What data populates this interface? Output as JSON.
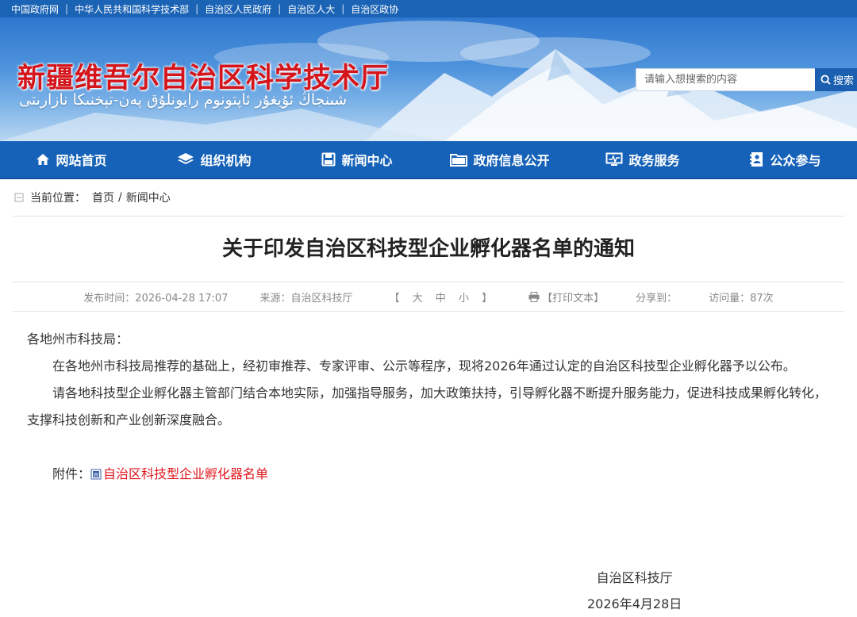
{
  "topbar": {
    "links": [
      "中国政府网",
      "中华人民共和国科学技术部",
      "自治区人民政府",
      "自治区人大",
      "自治区政协"
    ]
  },
  "banner": {
    "title": "新疆维吾尔自治区科学技术厅",
    "subtitle": "شىنجاڭ ئۇيغۇر ئاپتونوم رايونلۇق پەن-تېخنىكا نازارىتى",
    "title_color": "#d4151b"
  },
  "search": {
    "placeholder": "请输入想搜索的内容",
    "button_label": "搜索"
  },
  "nav": {
    "items": [
      {
        "label": "网站首页",
        "icon": "home-icon"
      },
      {
        "label": "组织机构",
        "icon": "layers-icon"
      },
      {
        "label": "新闻中心",
        "icon": "save-icon"
      },
      {
        "label": "政府信息公开",
        "icon": "folder-icon"
      },
      {
        "label": "政务服务",
        "icon": "monitor-icon"
      },
      {
        "label": "公众参与",
        "icon": "contact-card-icon"
      }
    ],
    "background": "#1662b8"
  },
  "breadcrumb": {
    "prefix": "当前位置：",
    "home": "首页",
    "separator": "/",
    "current": "新闻中心"
  },
  "article": {
    "title": "关于印发自治区科技型企业孵化器名单的通知",
    "meta": {
      "publish_time": "发布时间：2026-04-28 17:07",
      "source": "来源：自治区科技厅",
      "font_size_open": "【",
      "font_large": "大",
      "font_medium": "中",
      "font_small": "小",
      "font_size_close": "】",
      "print": "【打印文本】",
      "share": "分享到：",
      "visits": "访问量：87次"
    },
    "greeting": "各地州市科技局：",
    "paragraphs": [
      "在各地州市科技局推荐的基础上，经初审推荐、专家评审、公示等程序，现将2026年通过认定的自治区科技型企业孵化器予以公布。",
      "请各地科技型企业孵化器主管部门结合本地实际，加强指导服务，加大政策扶持，引导孵化器不断提升服务能力，促进科技成果孵化转化，支撑科技创新和产业创新深度融合。"
    ],
    "attachment_label": "附件：",
    "attachment_link": "自治区科技型企业孵化器名单",
    "attachment_color": "#e0171d",
    "signature_org": "自治区科技厅",
    "signature_date": "2026年4月28日"
  }
}
